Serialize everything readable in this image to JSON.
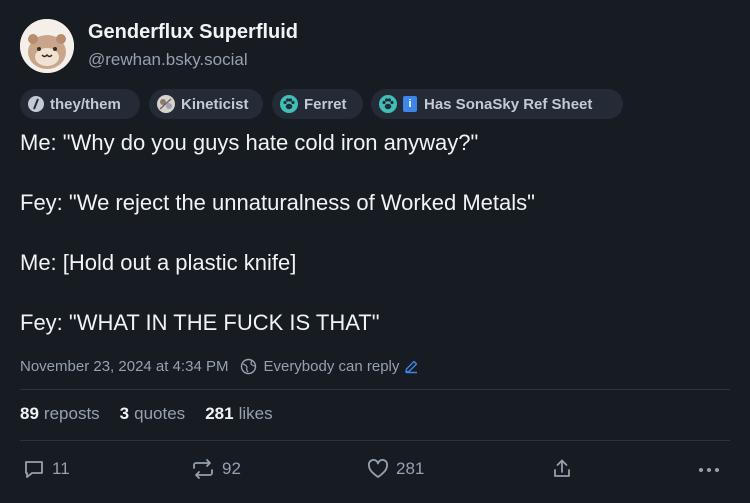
{
  "author": {
    "display_name": "Genderflux Superfluid",
    "handle": "@rewhan.bsky.social",
    "avatar": "hamster-avatar"
  },
  "labels": [
    {
      "text": "they/them",
      "icon": "pronoun-icon"
    },
    {
      "text": "Kineticist",
      "icon": "kineticist-icon"
    },
    {
      "text": "Ferret",
      "icon": "paw-icon"
    },
    {
      "text": "Has SonaSky Ref Sheet",
      "icon": "paw-icon",
      "badge": "i"
    }
  ],
  "post": {
    "lines": [
      "Me: \"Why do you guys hate cold iron anyway?\"",
      "Fey: \"We reject the unnaturalness of Worked Metals\"",
      "Me: [Hold out a plastic knife]",
      "Fey: \"WHAT IN THE FUCK IS THAT\""
    ]
  },
  "meta": {
    "timestamp": "November 23, 2024 at 4:34 PM",
    "reply_setting": "Everybody can reply"
  },
  "stats": {
    "reposts": {
      "count": "89",
      "label": "reposts"
    },
    "quotes": {
      "count": "3",
      "label": "quotes"
    },
    "likes": {
      "count": "281",
      "label": "likes"
    }
  },
  "actions": {
    "reply_count": "11",
    "repost_count": "92",
    "like_count": "281"
  },
  "colors": {
    "background": "#171b22",
    "chip": "#252b36",
    "accent": "#3b86e8",
    "muted": "#95a1af"
  }
}
